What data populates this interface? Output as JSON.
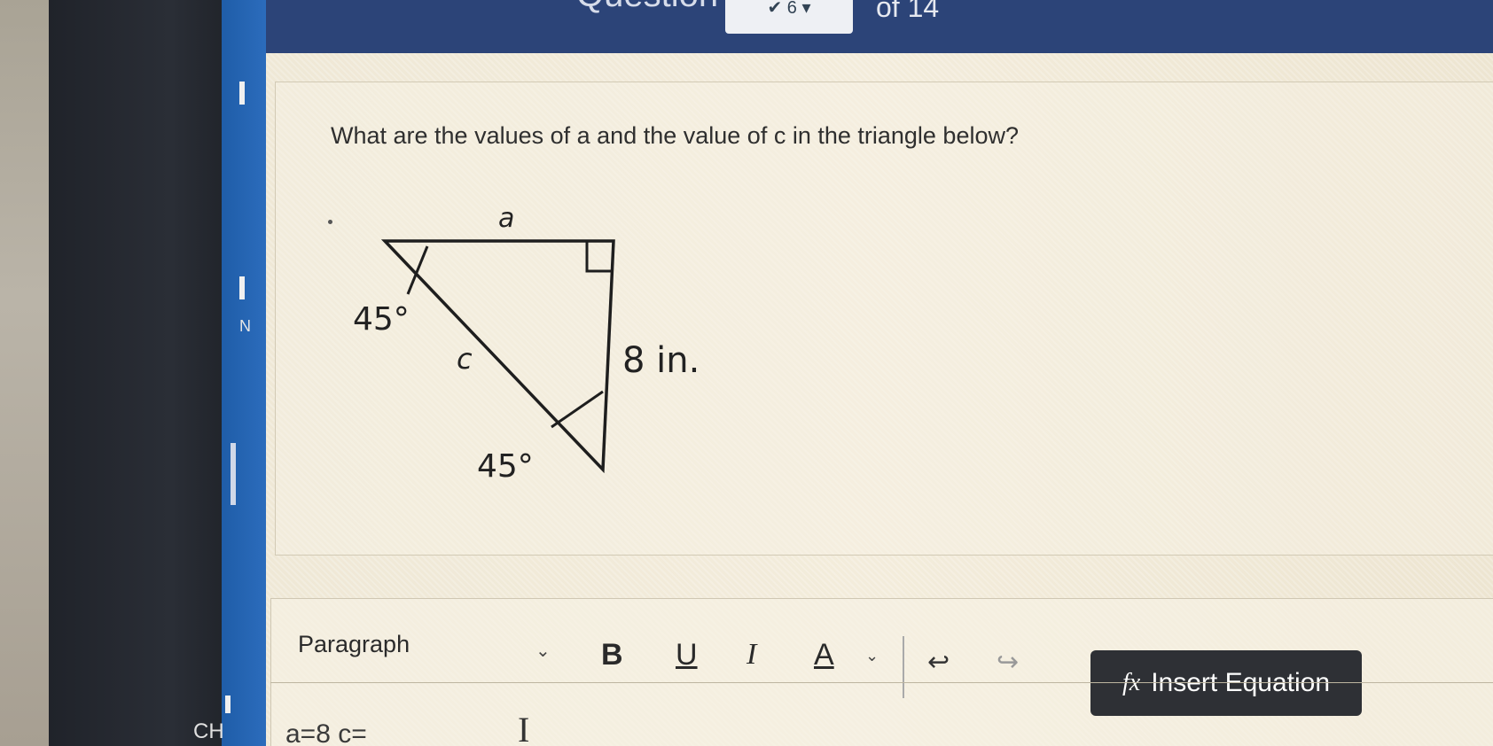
{
  "header": {
    "question_label": "Question",
    "question_select": "6",
    "of_label": "of 14"
  },
  "question": {
    "text": "What are the values of a and the value of c in the triangle below?"
  },
  "triangle": {
    "label_a": "a",
    "label_c": "c",
    "angle_top": "45°",
    "angle_bottom": "45°",
    "side_right": "8 in."
  },
  "editor": {
    "paragraph_label": "Paragraph",
    "bold": "B",
    "underline": "U",
    "italic": "I",
    "text_color": "A",
    "undo": "↩",
    "redo": "↪",
    "insert_equation_icon": "fx",
    "insert_equation_label": "Insert Equation",
    "answer_text": "a=8 c="
  },
  "side_strip": {
    "letter": "N",
    "bottom_label": "CH"
  },
  "colors": {
    "topbar": "#2c4478",
    "button_dark": "#2e3035",
    "content_bg": "#f0e9d7"
  }
}
